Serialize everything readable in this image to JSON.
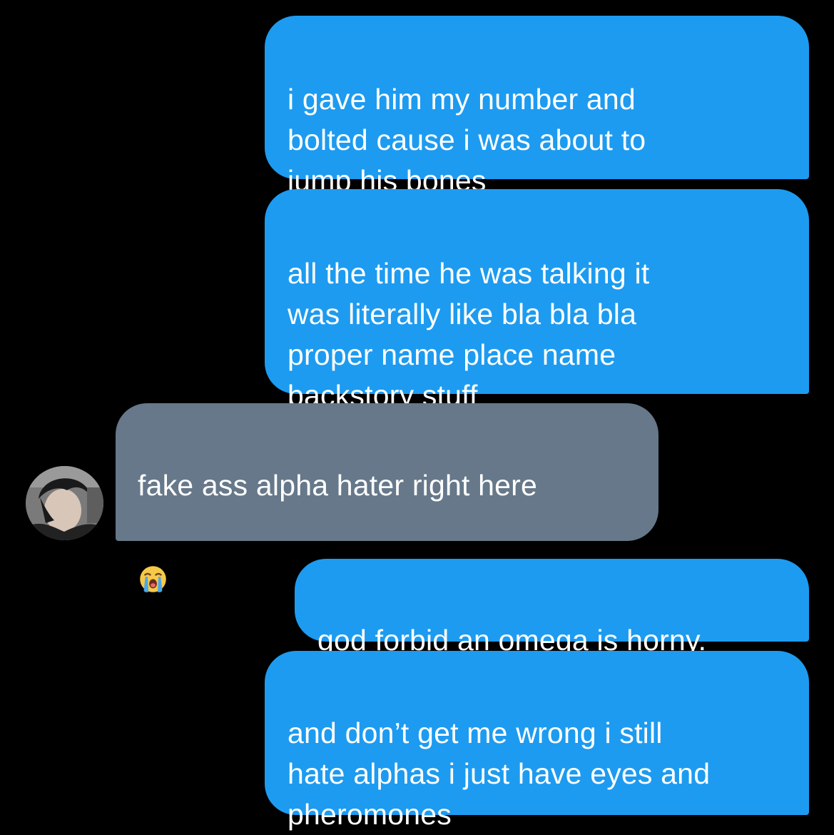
{
  "messages": [
    {
      "from": "me",
      "text": "i gave him my number and\nbolted cause i was about to\njump his bones"
    },
    {
      "from": "me",
      "text": "all the time he was talking it\nwas literally like bla bla bla\nproper name place name\nbackstory stuff"
    },
    {
      "from": "other",
      "text": "fake ass alpha hater right here",
      "emoji": "crying-loudly-emoji"
    },
    {
      "from": "me",
      "text": "god forbid an omega is horny."
    },
    {
      "from": "me",
      "text": "and don’t get me wrong i still\nhate alphas i just have eyes and\npheromones"
    }
  ],
  "colors": {
    "background": "#000000",
    "sent_bubble": "#1d9bf0",
    "received_bubble": "#66788a",
    "text": "#ffffff"
  }
}
